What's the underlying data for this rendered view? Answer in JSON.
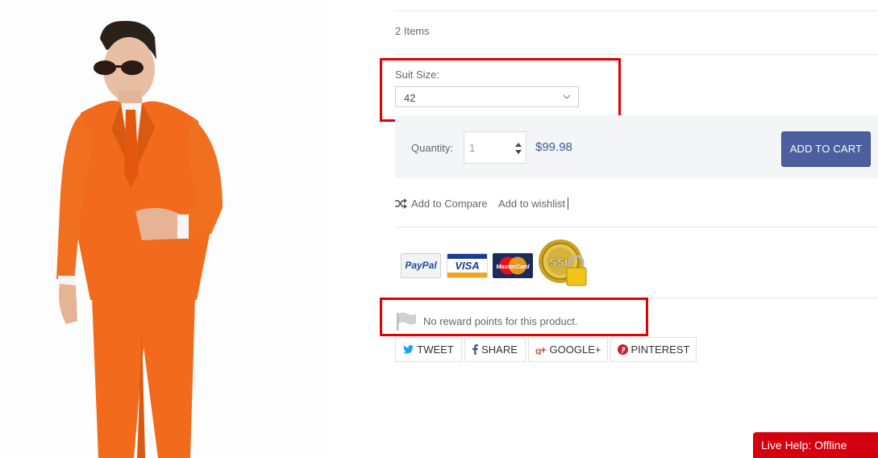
{
  "product": {
    "items_count": "2 Items",
    "size": {
      "label": "Suit Size:",
      "selected": "42"
    },
    "quantity": {
      "label": "Quantity:",
      "placeholder": "1"
    },
    "price": "$99.98",
    "add_to_cart_label": "ADD TO CART",
    "compare_label": "Add to Compare",
    "wishlist_label": "Add to wishlist"
  },
  "payment_icons": [
    "paypal-icon",
    "visa-icon",
    "mastercard-icon",
    "ssl-lock-badge-icon"
  ],
  "payment_labels": {
    "paypal": "PayPal",
    "visa": "VISA",
    "mastercard": "MasterCard",
    "ssl": "SSL"
  },
  "reward": {
    "text": "No reward points for this product."
  },
  "social": {
    "tweet": "TWEET",
    "share": "SHARE",
    "google": "GOOGLE+",
    "pinterest": "PINTEREST"
  },
  "live_help": "Live Help: Offline",
  "colors": {
    "accent_button": "#4c5f9e",
    "price": "#3f5a91",
    "annotation": "#e00000",
    "live_help": "#d4000f",
    "suit": "#f26a1b"
  }
}
